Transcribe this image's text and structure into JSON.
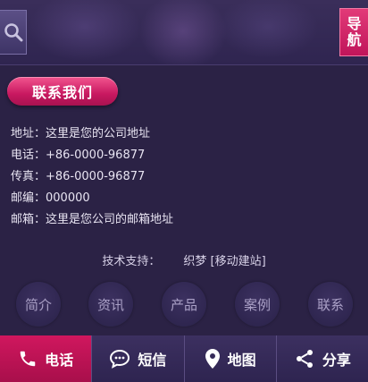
{
  "header": {
    "search_icon": "search-icon",
    "nav_label_1": "导",
    "nav_label_2": "航"
  },
  "contact": {
    "title": "联系我们",
    "lines": [
      "地址：这里是您的公司地址",
      "电话：+86-0000-96877",
      "传真：+86-0000-96877",
      "邮编：000000",
      "邮箱：这里是您公司的邮箱地址"
    ]
  },
  "support": {
    "label": "技术支持：",
    "value": "织梦 [移动建站]"
  },
  "round_nav": [
    "简介",
    "资讯",
    "产品",
    "案例",
    "联系"
  ],
  "bottom_bar": {
    "items": [
      {
        "label": "电话",
        "icon": "phone-icon"
      },
      {
        "label": "短信",
        "icon": "message-icon"
      },
      {
        "label": "地图",
        "icon": "map-pin-icon"
      },
      {
        "label": "分享",
        "icon": "share-icon"
      }
    ]
  },
  "colors": {
    "background": "#2b2245",
    "accent": "#c8185e",
    "bar": "#352a58"
  }
}
